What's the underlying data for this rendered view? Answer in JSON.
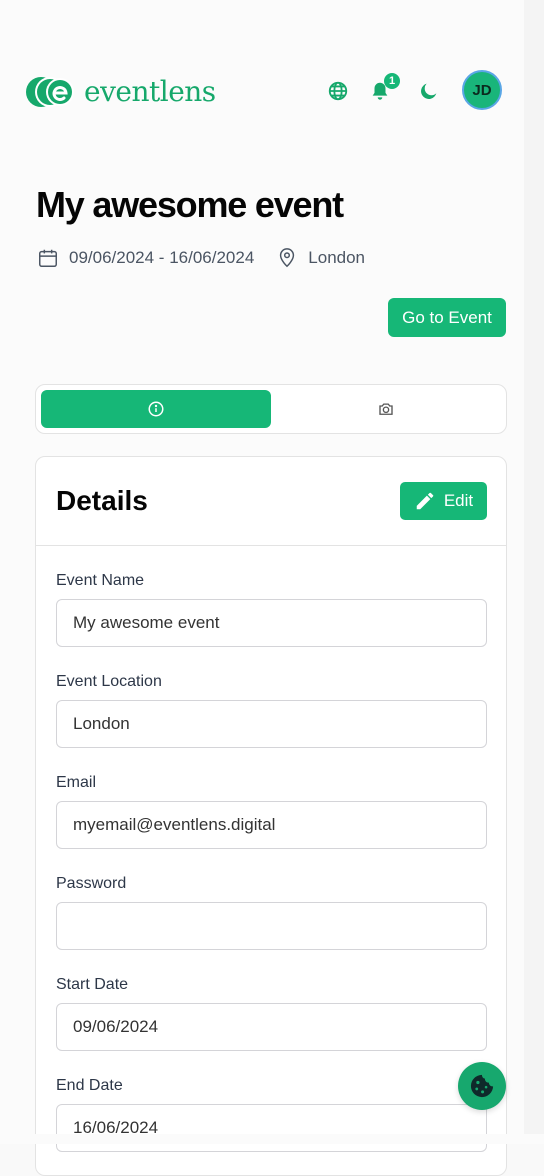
{
  "header": {
    "logo_text": "eventlens",
    "notification_count": "1",
    "avatar_initials": "JD",
    "colors": {
      "brand": "#16b777",
      "brand_dark": "#16a86b"
    }
  },
  "event": {
    "title": "My awesome event",
    "date_range": "09/06/2024 - 16/06/2024",
    "location": "London",
    "goto_label": "Go to Event"
  },
  "tabs": [
    {
      "icon": "info-icon",
      "active": true
    },
    {
      "icon": "camera-icon",
      "active": false
    }
  ],
  "details": {
    "title": "Details",
    "edit_label": "Edit",
    "fields": {
      "event_name": {
        "label": "Event Name",
        "value": "My awesome event"
      },
      "event_location": {
        "label": "Event Location",
        "value": "London"
      },
      "email": {
        "label": "Email",
        "value": "myemail@eventlens.digital"
      },
      "password": {
        "label": "Password",
        "value": ""
      },
      "start_date": {
        "label": "Start Date",
        "value": "09/06/2024"
      },
      "end_date": {
        "label": "End Date",
        "value": "16/06/2024"
      }
    }
  },
  "fab": {
    "icon": "cookie-icon"
  }
}
